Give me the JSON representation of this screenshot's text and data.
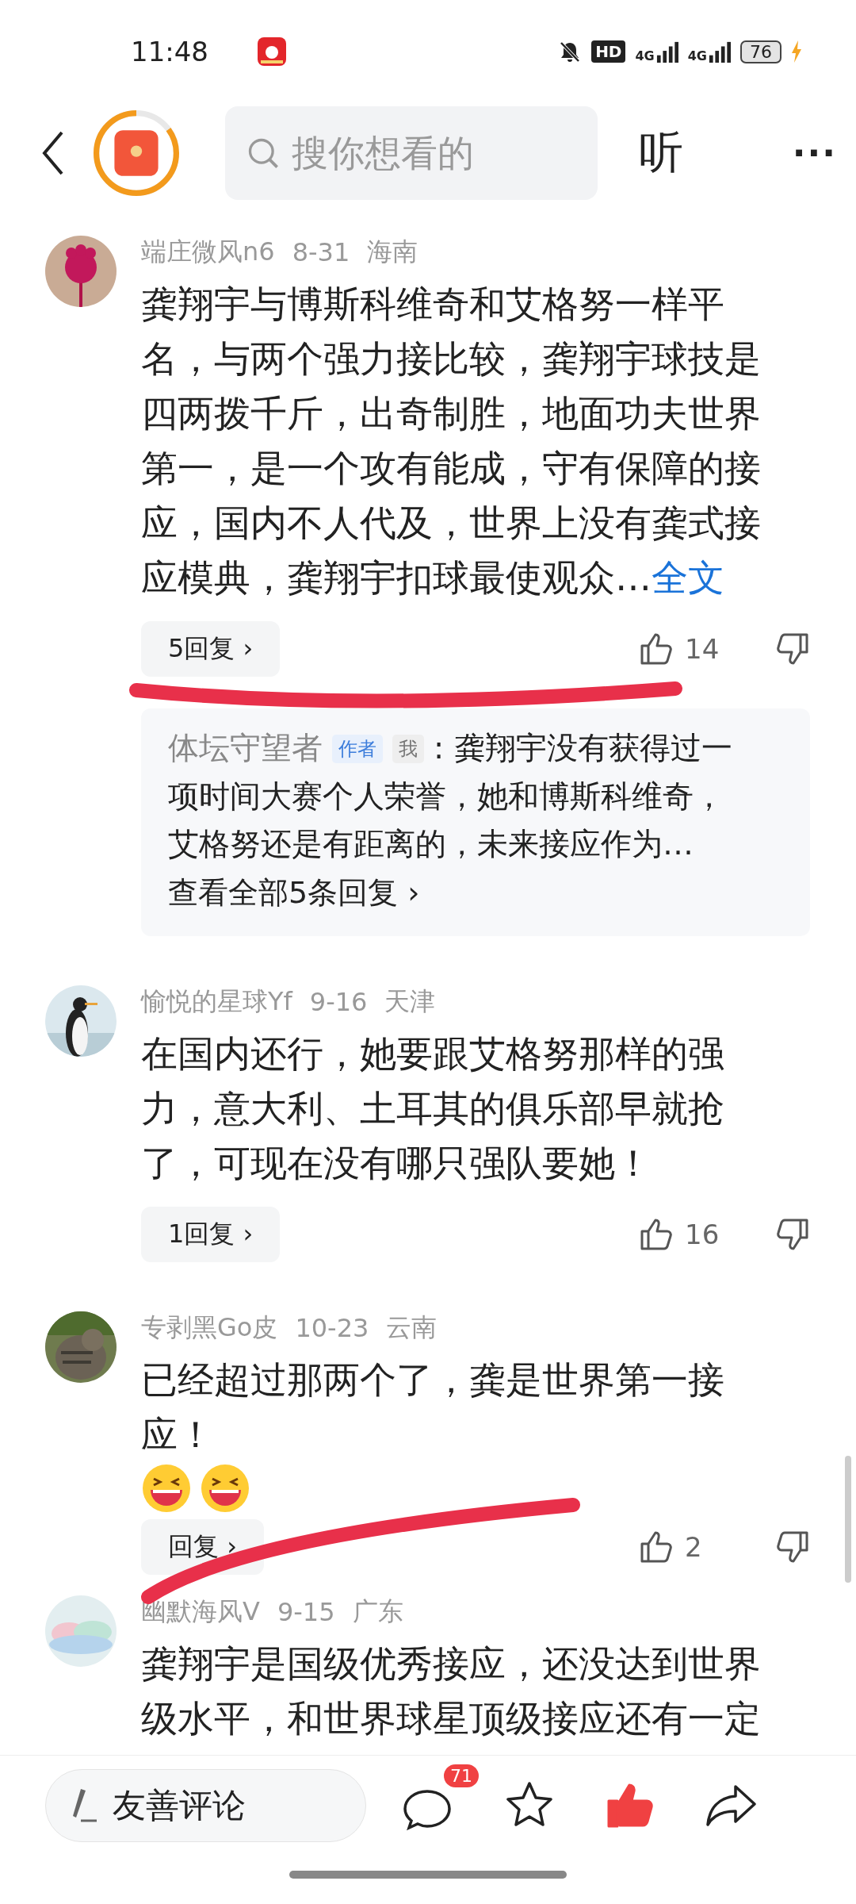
{
  "status_bar": {
    "time": "11:48",
    "hd": "HD",
    "networks": [
      "4G",
      "4G"
    ],
    "battery": "76"
  },
  "top_bar": {
    "reward": {
      "level": 0.85
    },
    "search": {
      "placeholder": "搜你想看的"
    },
    "listen": "听",
    "more": "···"
  },
  "comments": [
    {
      "user": "端庄微风n6",
      "date": "8-31",
      "region": "海南",
      "body": "龚翔宇与博斯科维奇和艾格努一样平名，与两个强力接比较，龚翔宇球技是四两拨千斤，出奇制胜，地面功夫世界第一，是一个攻有能成，守有保障的接应，国内不人代及，世界上没有龚式接应模典，龚翔宇扣球最使观众…",
      "more_link": "全文",
      "reply_button": "5回复 ›",
      "likes": "14",
      "liked": false,
      "reply_preview": {
        "author": "体坛守望者",
        "badges": [
          {
            "kind": "author",
            "label": "作者"
          },
          {
            "kind": "me",
            "label": "我"
          }
        ],
        "text": ": 龚翔宇没有获得过一项时间大赛个人荣誉，她和博斯科维奇，艾格努还是有距离的，未来接应作为…",
        "view_all": "查看全部5条回复 ›"
      }
    },
    {
      "user": "愉悦的星球Yf",
      "date": "9-16",
      "region": "天津",
      "body": "在国内还行，她要跟艾格努那样的强力，意大利、土耳其的俱乐部早就抢了，可现在没有哪只强队要她！",
      "reply_button": "1回复 ›",
      "likes": "16",
      "liked": false
    },
    {
      "user": "专剥黑Go皮",
      "date": "10-23",
      "region": "云南",
      "body": "已经超过那两个了，龚是世界第一接应！",
      "stickers": [
        {
          "kind": "laugh"
        },
        {
          "kind": "laugh"
        }
      ],
      "reply_button": "回复 ›",
      "likes": "2",
      "liked": false
    },
    {
      "user": "幽默海风V",
      "date": "9-15",
      "region": "广东",
      "body": "龚翔宇是国级优秀接应，还没达到世界级水平，和世界球星顶级接应还有一定"
    }
  ],
  "bottom_bar": {
    "comment_field": {
      "placeholder": "友善评论"
    },
    "comment_count": "71",
    "favorited": false,
    "liked": true
  }
}
